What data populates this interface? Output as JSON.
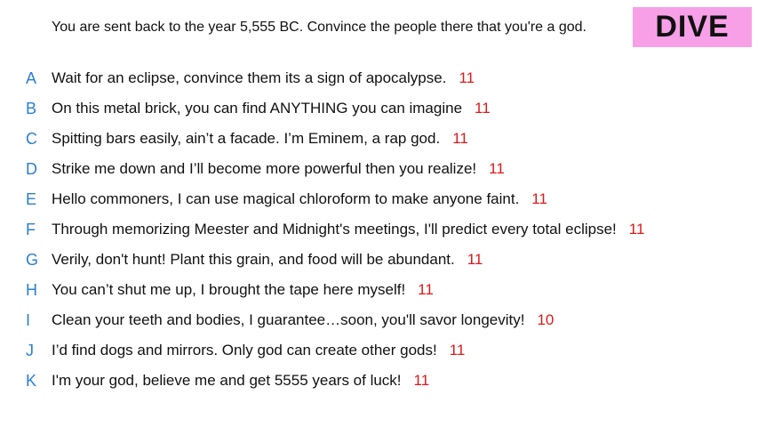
{
  "prompt": "You are sent back to the year 5,555 BC. Convince the people there that you're a god.",
  "badge": "DIVE",
  "colors": {
    "badge_bg": "#f7a0e8",
    "letter": "#2a7fd4",
    "score": "#e01818"
  },
  "answers": [
    {
      "letter": "A",
      "text": "Wait for an eclipse, convince them its a sign of apocalypse.",
      "score": "11"
    },
    {
      "letter": "B",
      "text": "On this metal brick, you can find ANYTHING you can imagine",
      "score": "11"
    },
    {
      "letter": "C",
      "text": "Spitting bars easily, ain’t a facade. I’m Eminem, a rap god.",
      "score": "11"
    },
    {
      "letter": "D",
      "text": "Strike me down and I’ll become more powerful then you realize!",
      "score": "11"
    },
    {
      "letter": "E",
      "text": "Hello commoners, I can use magical chloroform to make anyone faint.",
      "score": "11"
    },
    {
      "letter": "F",
      "text": "Through memorizing Meester and Midnight's meetings, I'll predict every total eclipse!",
      "score": "11"
    },
    {
      "letter": "G",
      "text": "Verily, don't hunt! Plant this grain, and food will be abundant.",
      "score": "11"
    },
    {
      "letter": "H",
      "text": "You can’t shut me up, I brought the tape here myself!",
      "score": "11"
    },
    {
      "letter": "I",
      "text": "Clean your teeth and bodies, I guarantee…soon, you'll savor longevity!",
      "score": "10"
    },
    {
      "letter": "J",
      "text": "I’d find dogs and mirrors. Only god can create other gods!",
      "score": "11"
    },
    {
      "letter": "K",
      "text": "I'm your god, believe me and get 5555 years of luck!",
      "score": "11"
    }
  ]
}
